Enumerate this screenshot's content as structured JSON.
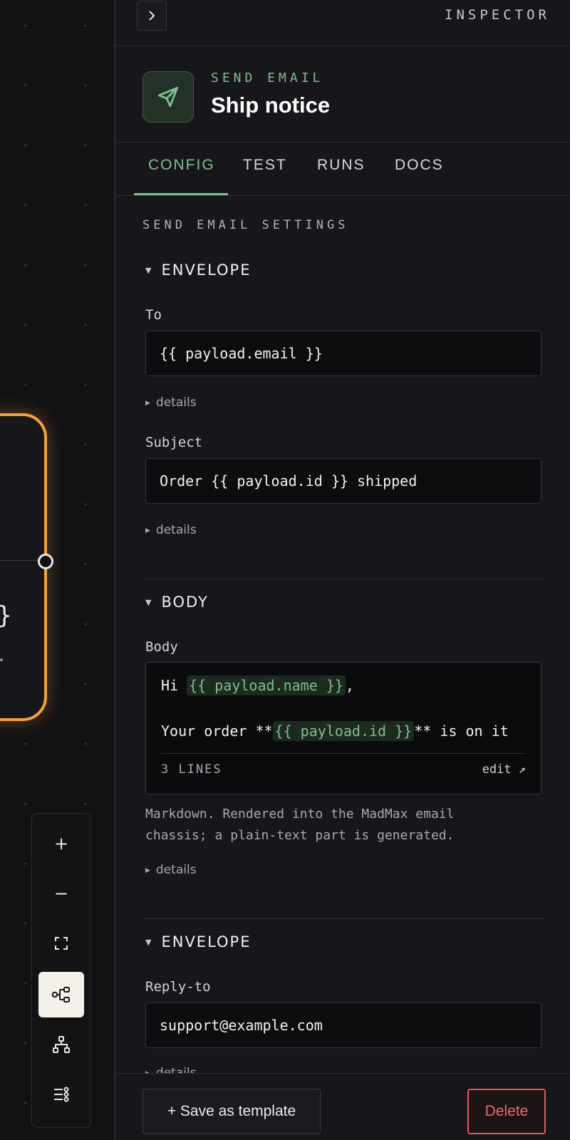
{
  "inspector": {
    "label": "INSPECTOR",
    "collapse_icon": "chevron-right-icon"
  },
  "node": {
    "kind": "SEND EMAIL",
    "title": "Ship notice",
    "icon": "send-icon",
    "accent_color": "#7fbf8f"
  },
  "tabs": [
    {
      "label": "CONFIG",
      "active": true
    },
    {
      "label": "TEST",
      "active": false
    },
    {
      "label": "RUNS",
      "active": false
    },
    {
      "label": "DOCS",
      "active": false
    }
  ],
  "settings": {
    "section_title": "SEND EMAIL SETTINGS",
    "groups": [
      {
        "name": "ENVELOPE",
        "fields": [
          {
            "label": "To",
            "value": "{{ payload.email }}",
            "details": "details"
          },
          {
            "label": "Subject",
            "value": "Order {{ payload.id }} shipped",
            "details": "details"
          }
        ]
      },
      {
        "name": "BODY",
        "fields": [
          {
            "label": "Body",
            "line1_prefix": "Hi ",
            "line1_var": "{{ payload.name }}",
            "line1_suffix": ",",
            "line2_prefix": "Your order **",
            "line2_var": "{{ payload.id }}",
            "line2_suffix": "** is on it",
            "line_count": "3 LINES",
            "edit_label": "edit ↗",
            "help": "Markdown. Rendered into the MadMax email chassis; a plain-text part is generated.",
            "details": "details"
          }
        ]
      },
      {
        "name": "ENVELOPE",
        "fields": [
          {
            "label": "Reply-to",
            "value": "support@example.com",
            "details": "details"
          }
        ]
      }
    ]
  },
  "footer": {
    "save_template_label": "+ Save as template",
    "delete_label": "Delete",
    "delete_color": "#e25c5c"
  },
  "canvas": {
    "node_highlight_color": "#f5a13b",
    "node_brace_text": "}",
    "toolbar": [
      {
        "icon": "zoom-in-icon",
        "glyph": "+"
      },
      {
        "icon": "zoom-out-icon",
        "glyph": "−"
      },
      {
        "icon": "fit-view-icon"
      },
      {
        "icon": "auto-layout-icon",
        "active": true
      },
      {
        "icon": "hierarchy-icon"
      },
      {
        "icon": "list-settings-icon"
      }
    ]
  }
}
